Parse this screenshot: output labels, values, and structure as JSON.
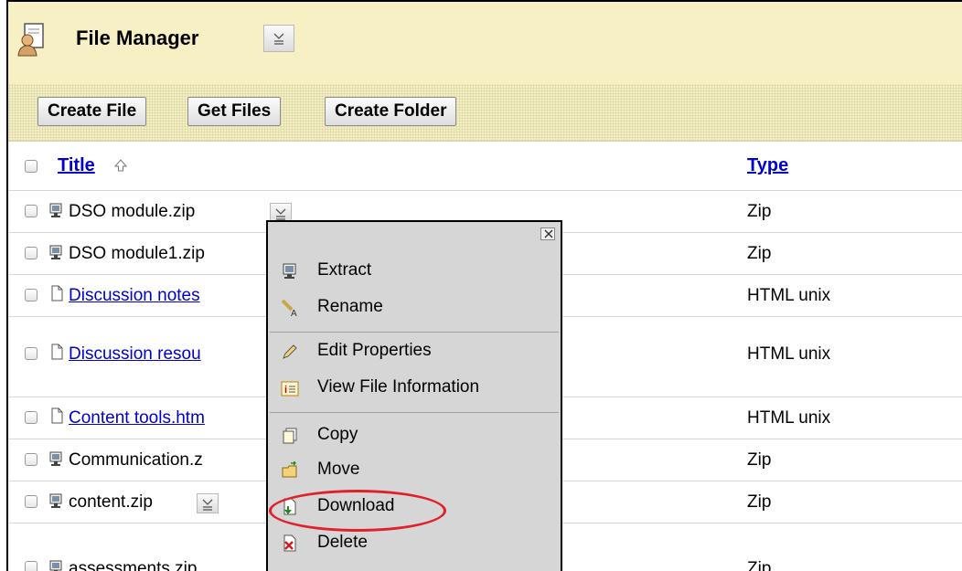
{
  "header": {
    "title": "File Manager"
  },
  "toolbar": {
    "create_file": "Create File",
    "get_files": "Get Files",
    "create_folder": "Create Folder"
  },
  "columns": {
    "title": "Title",
    "type": "Type"
  },
  "rows": [
    {
      "name": "DSO module.zip",
      "type": "Zip",
      "kind": "zip",
      "link": false
    },
    {
      "name": "DSO module1.zip",
      "type": "Zip",
      "kind": "zip",
      "link": false
    },
    {
      "name": "Discussion notes",
      "type": "HTML unix",
      "kind": "doc",
      "link": true
    },
    {
      "name": "Discussion resou",
      "type": "HTML unix",
      "kind": "doc",
      "link": true
    },
    {
      "name": "Content tools.htm",
      "type": "HTML unix",
      "kind": "doc",
      "link": true
    },
    {
      "name": "Communication.z",
      "type": "Zip",
      "kind": "zip",
      "link": false
    },
    {
      "name": "content.zip",
      "type": "Zip",
      "kind": "zip",
      "link": false
    },
    {
      "name": "assessments.zip",
      "type": "Zip",
      "kind": "zip",
      "link": false
    }
  ],
  "menu": {
    "extract": "Extract",
    "rename": "Rename",
    "edit_properties": "Edit Properties",
    "view_file_information": "View File Information",
    "copy": "Copy",
    "move": "Move",
    "download": "Download",
    "delete": "Delete"
  },
  "colors": {
    "header_bg": "#f7f0c4",
    "link": "#0000cc",
    "highlight": "#e0202a"
  }
}
